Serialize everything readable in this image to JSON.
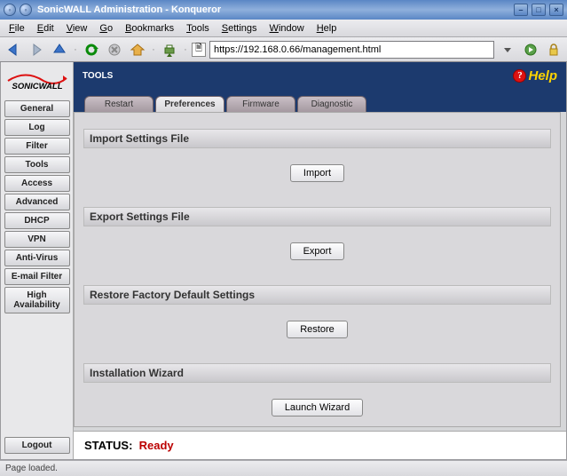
{
  "window": {
    "title": "SonicWALL Administration - Konqueror"
  },
  "menubar": {
    "file": "File",
    "edit": "Edit",
    "view": "View",
    "go": "Go",
    "bookmarks": "Bookmarks",
    "tools": "Tools",
    "settings": "Settings",
    "window": "Window",
    "help": "Help"
  },
  "toolbar": {
    "url": "https://192.168.0.66/management.html"
  },
  "sidebar": {
    "items": [
      {
        "label": "General"
      },
      {
        "label": "Log"
      },
      {
        "label": "Filter"
      },
      {
        "label": "Tools"
      },
      {
        "label": "Access"
      },
      {
        "label": "Advanced"
      },
      {
        "label": "DHCP"
      },
      {
        "label": "VPN"
      },
      {
        "label": "Anti-Virus"
      },
      {
        "label": "E-mail Filter"
      },
      {
        "label": "High Availability"
      }
    ],
    "logout": "Logout"
  },
  "header": {
    "title": "TOOLS",
    "help": "Help"
  },
  "tabs": [
    {
      "label": "Restart"
    },
    {
      "label": "Preferences"
    },
    {
      "label": "Firmware"
    },
    {
      "label": "Diagnostic"
    }
  ],
  "sections": {
    "import": {
      "title": "Import Settings File",
      "button": "Import"
    },
    "export": {
      "title": "Export Settings File",
      "button": "Export"
    },
    "restore": {
      "title": "Restore Factory Default Settings",
      "button": "Restore"
    },
    "wizard": {
      "title": "Installation Wizard",
      "button": "Launch Wizard"
    }
  },
  "status": {
    "label": "STATUS:",
    "value": "Ready"
  },
  "footer": {
    "text": "Page loaded."
  }
}
